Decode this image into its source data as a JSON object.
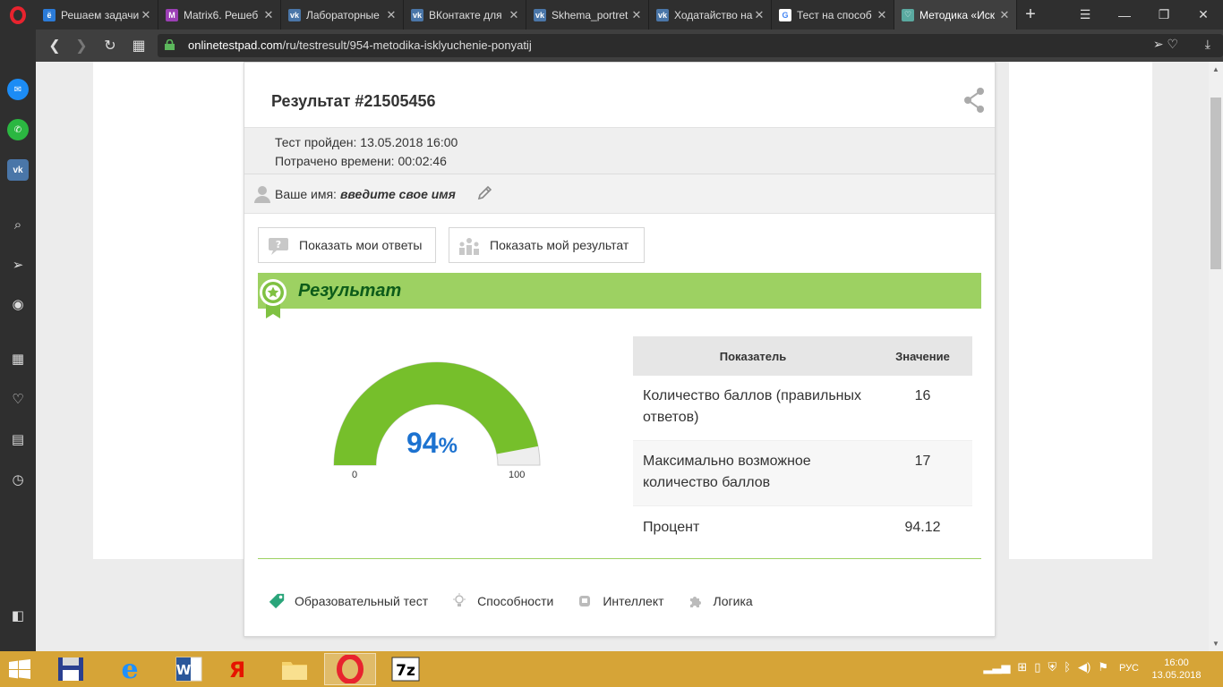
{
  "browser": {
    "tabs": [
      {
        "label": "Решаем задачи",
        "fav": "ё",
        "color": "#2b7bd8"
      },
      {
        "label": "Matrix6. Решеб",
        "fav": "M",
        "color": "#9b3fb5"
      },
      {
        "label": "Лабораторные",
        "fav": "vk",
        "color": "#4a76a8"
      },
      {
        "label": "ВКонтакте для",
        "fav": "vk",
        "color": "#4a76a8"
      },
      {
        "label": "Skhema_portret",
        "fav": "vk",
        "color": "#4a76a8"
      },
      {
        "label": "Ходатайство на",
        "fav": "vk",
        "color": "#4a76a8"
      },
      {
        "label": "Тест на способ",
        "fav": "G",
        "color": "#ffffff"
      },
      {
        "label": "Методика «Иск",
        "fav": "♡",
        "color": "#5aa9a0"
      }
    ],
    "new_tab": "+",
    "url_host": "onlinetestpad.com",
    "url_path": "/ru/testresult/954-metodika-isklyuchenie-ponyatij"
  },
  "result": {
    "title": "Результат #21505456",
    "passed_label": "Тест пройден:",
    "passed_value": "13.05.2018 16:00",
    "time_label": "Потрачено времени:",
    "time_value": "00:02:46",
    "name_label": "Ваше имя:",
    "name_value": "введите свое имя"
  },
  "buttons": {
    "show_answers": "Показать мои ответы",
    "show_result": "Показать мой результат"
  },
  "section_title": "Результат",
  "gauge": {
    "value": 94,
    "unit": "%",
    "min": "0",
    "max": "100",
    "fraction": 0.9412,
    "color": "#76bf2b"
  },
  "table": {
    "headers": [
      "Показатель",
      "Значение"
    ],
    "rows": [
      {
        "label": "Количество баллов (правильных ответов)",
        "value": "16"
      },
      {
        "label": "Максимально возможное количество баллов",
        "value": "17"
      },
      {
        "label": "Процент",
        "value": "94.12"
      }
    ]
  },
  "tags": [
    "Образовательный тест",
    "Способности",
    "Интеллект",
    "Логика"
  ],
  "taskbar": {
    "lang": "РУС",
    "time": "16:00",
    "date": "13.05.2018"
  },
  "colors": {
    "accent_green": "#9dd162",
    "dark_green": "#0d5c1a",
    "value_blue": "#1c72d0",
    "taskbar": "#d6a437"
  }
}
